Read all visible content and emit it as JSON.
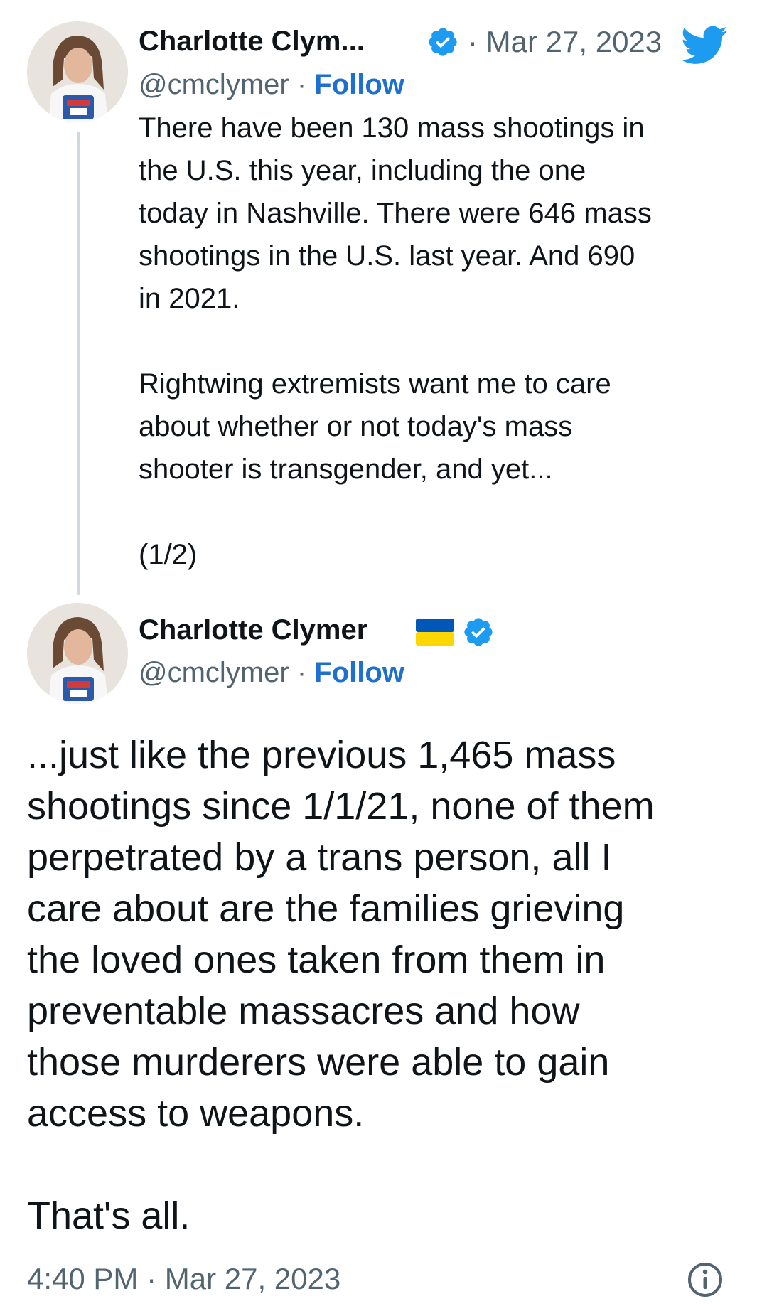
{
  "tweet1": {
    "display_name": "Charlotte Clym...",
    "handle": "@cmclymer",
    "separator": "·",
    "follow_label": "Follow",
    "date": "· Mar 27, 2023",
    "body": "There have been 130 mass shootings in\nthe U.S. this year, including the one\ntoday in Nashville. There were 646 mass\nshootings in the U.S. last year. And 690\nin 2021.\n\nRightwing extremists want me to care\nabout whether or not today's mass\nshooter is transgender, and yet...\n\n(1/2)"
  },
  "tweet2": {
    "display_name": "Charlotte Clymer",
    "handle": "@cmclymer",
    "separator": "·",
    "follow_label": "Follow",
    "body": "...just like the previous 1,465 mass\nshootings since 1/1/21, none of them\nperpetrated by a trans person, all I\ncare about are the families grieving\nthe loved ones taken from them in\npreventable massacres and how\nthose murderers were able to gain\naccess to weapons.\n\nThat's all.",
    "timestamp": "4:40 PM · Mar 27, 2023"
  },
  "icons": {
    "verified": "verified-badge-icon",
    "brand": "twitter-bird-icon",
    "flag": "ukraine-flag-icon",
    "info": "info-icon"
  },
  "colors": {
    "verified_blue": "#1d9bf0",
    "follow_blue": "#1d6fd0",
    "twitter_blue": "#1d9bf0",
    "flag_blue": "#0057b7",
    "flag_yellow": "#ffd700"
  }
}
